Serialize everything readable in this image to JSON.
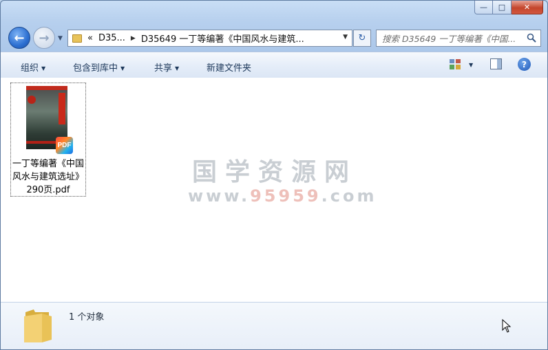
{
  "window": {
    "controls": {
      "minimize": "—",
      "maximize": "□",
      "close": "✕"
    }
  },
  "navigation": {
    "back_glyph": "←",
    "forward_glyph": "→",
    "address": {
      "prefix": "«",
      "crumbs": [
        "D35...",
        "D35649 一丁等编著《中国风水与建筑..."
      ]
    },
    "refresh_glyph": "↻",
    "search": {
      "placeholder": "搜索 D35649 一丁等编著《中国..."
    }
  },
  "toolbar": {
    "organize": "组织",
    "include_in_library": "包含到库中",
    "share": "共享",
    "new_folder": "新建文件夹",
    "help_glyph": "?"
  },
  "files": [
    {
      "name": "一丁等编著《中国风水与建筑选址》290页.pdf",
      "badge": "PDF"
    }
  ],
  "watermark": {
    "title": "国学资源网",
    "url_prefix": "www.",
    "url_number": "95959",
    "url_suffix": ".com"
  },
  "status": {
    "count_text": "1 个对象"
  }
}
